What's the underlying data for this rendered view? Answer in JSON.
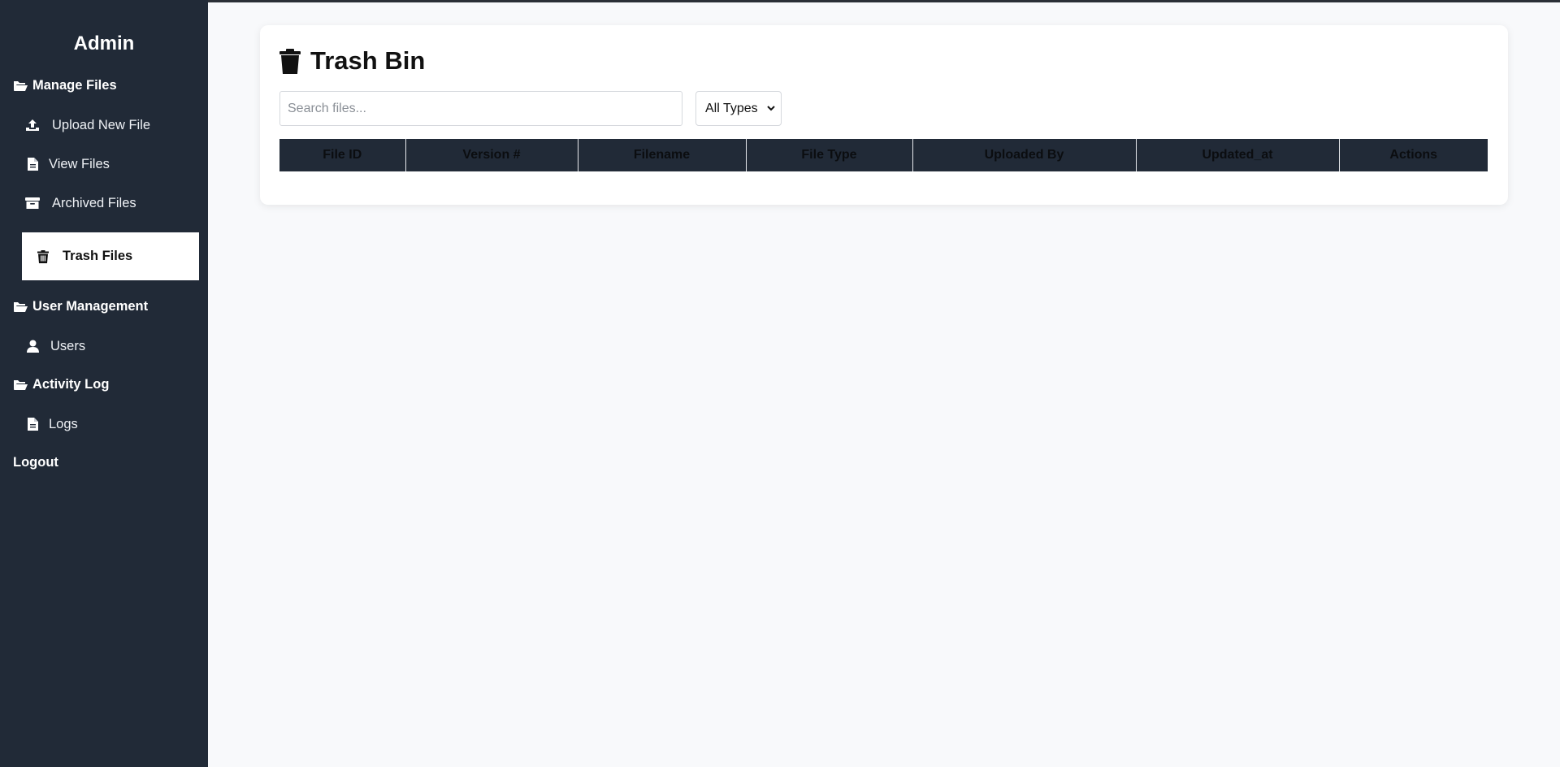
{
  "sidebar": {
    "brand": "Admin",
    "sections": [
      {
        "label": "Manage Files",
        "items": [
          {
            "label": "Upload New File",
            "icon": "upload-icon"
          },
          {
            "label": "View Files",
            "icon": "file-icon"
          },
          {
            "label": "Archived Files",
            "icon": "archive-box-icon"
          },
          {
            "label": "Trash Files",
            "icon": "trash-icon",
            "active": true
          }
        ]
      },
      {
        "label": "User Management",
        "items": [
          {
            "label": "Users",
            "icon": "user-icon"
          }
        ]
      },
      {
        "label": "Activity Log",
        "items": [
          {
            "label": "Logs",
            "icon": "file-icon"
          }
        ]
      }
    ],
    "logout": "Logout"
  },
  "main": {
    "title": "Trash Bin",
    "search": {
      "placeholder": "Search files...",
      "value": ""
    },
    "type_filter": {
      "selected": "All Types"
    },
    "table": {
      "columns": [
        "File ID",
        "Version #",
        "Filename",
        "File Type",
        "Uploaded By",
        "Updated_at",
        "Actions"
      ],
      "rows": []
    }
  },
  "colors": {
    "sidebar_bg": "#212a37",
    "page_bg": "#f8f9fb",
    "table_header_bg": "#212a37"
  }
}
